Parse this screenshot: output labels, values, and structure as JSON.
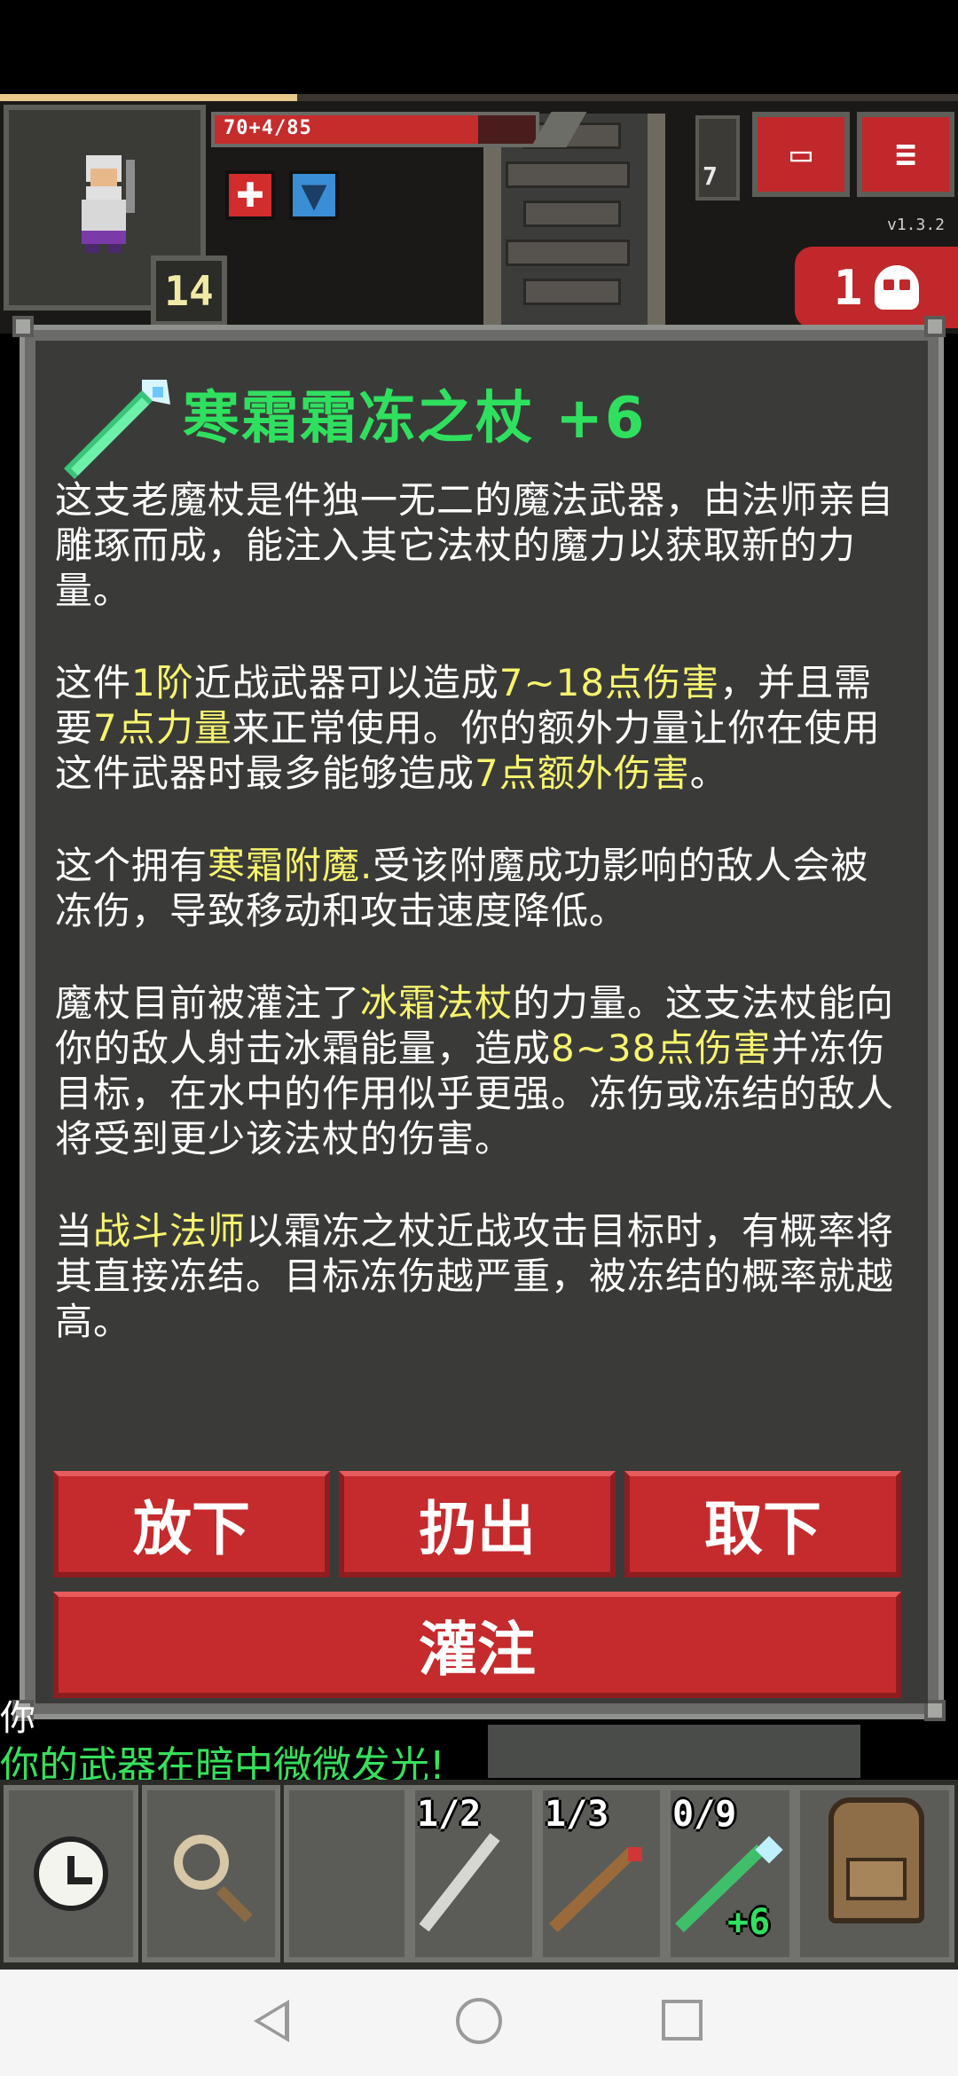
{
  "hud": {
    "hp_text": "70+4/85",
    "hp_fraction": 0.82,
    "xp_fraction": 0.31,
    "depth": "14",
    "keys": "7",
    "version": "v1.3.2",
    "danger_count": "1",
    "journal_icon": "journal-icon",
    "menu_icon": "menu-icon",
    "buffs": [
      "health-regen-buff",
      "shield-buff"
    ]
  },
  "item": {
    "title": "寒霜霜冻之杖 +6",
    "icon": "frost-staff-icon",
    "desc": {
      "p1": "这支老魔杖是件独一无二的魔法武器，由法师亲自雕琢而成，能注入其它法杖的魔力以获取新的力量。",
      "p2_a": "这件",
      "p2_tier": "1阶",
      "p2_b": "近战武器可以造成",
      "p2_dmg": "7~18点伤害",
      "p2_c": "，并且需要",
      "p2_str": "7点力量",
      "p2_d": "来正常使用。你的额外力量让你在使用这件武器时最多能够造成",
      "p2_bonus": "7点额外伤害",
      "p2_e": "。",
      "p3_a": "这个拥有",
      "p3_ench": "寒霜附魔.",
      "p3_b": "受该附魔成功影响的敌人会被冻伤，导致移动和攻击速度降低。",
      "p4_a": "魔杖目前被灌注了",
      "p4_wand": "冰霜法杖",
      "p4_b": "的力量。这支法杖能向你的敌人射击冰霜能量，造成",
      "p4_dmg": "8~38点伤害",
      "p4_c": "并冻伤目标，在水中的作用似乎更强。冻伤或冻结的敌人将受到更少该法杖的伤害。",
      "p5_a": "当",
      "p5_class": "战斗法师",
      "p5_b": "以霜冻之杖近战攻击目标时，有概率将其直接冻结。目标冻伤越严重，被冻结的概率就越高。"
    }
  },
  "actions": {
    "drop": "放下",
    "throw": "扔出",
    "unequip": "取下",
    "imbue": "灌注"
  },
  "log": {
    "line1": "你",
    "line2": "你的武器在暗中微微发光!"
  },
  "toolbar": {
    "quickslots": [
      {
        "charges": "1/2",
        "icon": "wand-icon"
      },
      {
        "charges": "1/3",
        "icon": "wand-icon"
      },
      {
        "charges": "0/9",
        "icon": "frost-wand-icon",
        "level": "+6"
      }
    ]
  },
  "colors": {
    "title": "#2fe05f",
    "highlight": "#f7f36e",
    "button": "#c52a2d",
    "log": "#37e05c"
  }
}
